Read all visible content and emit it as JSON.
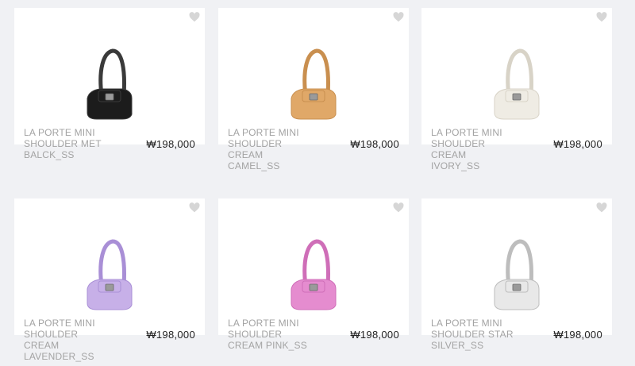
{
  "products": [
    {
      "name": "LA PORTE MINI\nSHOULDER MET\nBALCK_SS",
      "price": "₩198,000",
      "color": "#1c1c1c",
      "accent": "#3a3a3a"
    },
    {
      "name": "LA PORTE MINI\nSHOULDER\nCREAM\nCAMEL_SS",
      "price": "₩198,000",
      "color": "#e0a868",
      "accent": "#c98f4f"
    },
    {
      "name": "LA PORTE MINI\nSHOULDER\nCREAM\nIVORY_SS",
      "price": "₩198,000",
      "color": "#efece4",
      "accent": "#d8d3c7"
    },
    {
      "name": "LA PORTE MINI\nSHOULDER\nCREAM\nLAVENDER_SS",
      "price": "₩198,000",
      "color": "#c7b0e8",
      "accent": "#a98fd6"
    },
    {
      "name": "LA PORTE MINI\nSHOULDER\nCREAM PINK_SS",
      "price": "₩198,000",
      "color": "#e58ccf",
      "accent": "#cf6eb8"
    },
    {
      "name": "LA PORTE MINI\nSHOULDER STAR\nSILVER_SS",
      "price": "₩198,000",
      "color": "#e8e8e8",
      "accent": "#bdbdbd"
    }
  ],
  "icons": {
    "wishlist": "heart-icon"
  }
}
